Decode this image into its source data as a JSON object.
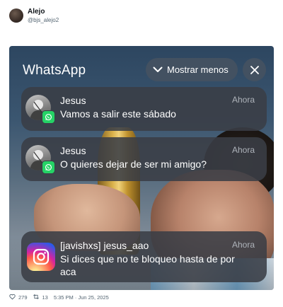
{
  "post": {
    "author_name": "Alejo",
    "author_handle": "@bjs_alejo2",
    "likes": "279",
    "reposts": "13",
    "timestamp": "5:35 PM · Jun 25, 2025"
  },
  "screenshot": {
    "app_title": "WhatsApp",
    "show_less_label": "Mostrar menos",
    "notifications": [
      {
        "app": "whatsapp",
        "sender": "Jesus",
        "time": "Ahora",
        "message": "Vamos a salir este sábado"
      },
      {
        "app": "whatsapp",
        "sender": "Jesus",
        "time": "Ahora",
        "message": "O quieres dejar de ser mi amigo?"
      },
      {
        "app": "instagram",
        "sender": "[javishxs] jesus_aao",
        "time": "Ahora",
        "message": "Si dices que no te bloqueo hasta de por aca"
      }
    ]
  },
  "colors": {
    "whatsapp_green": "#25d366",
    "notification_bg": "#3a3e46",
    "handle_gray": "#536471"
  }
}
